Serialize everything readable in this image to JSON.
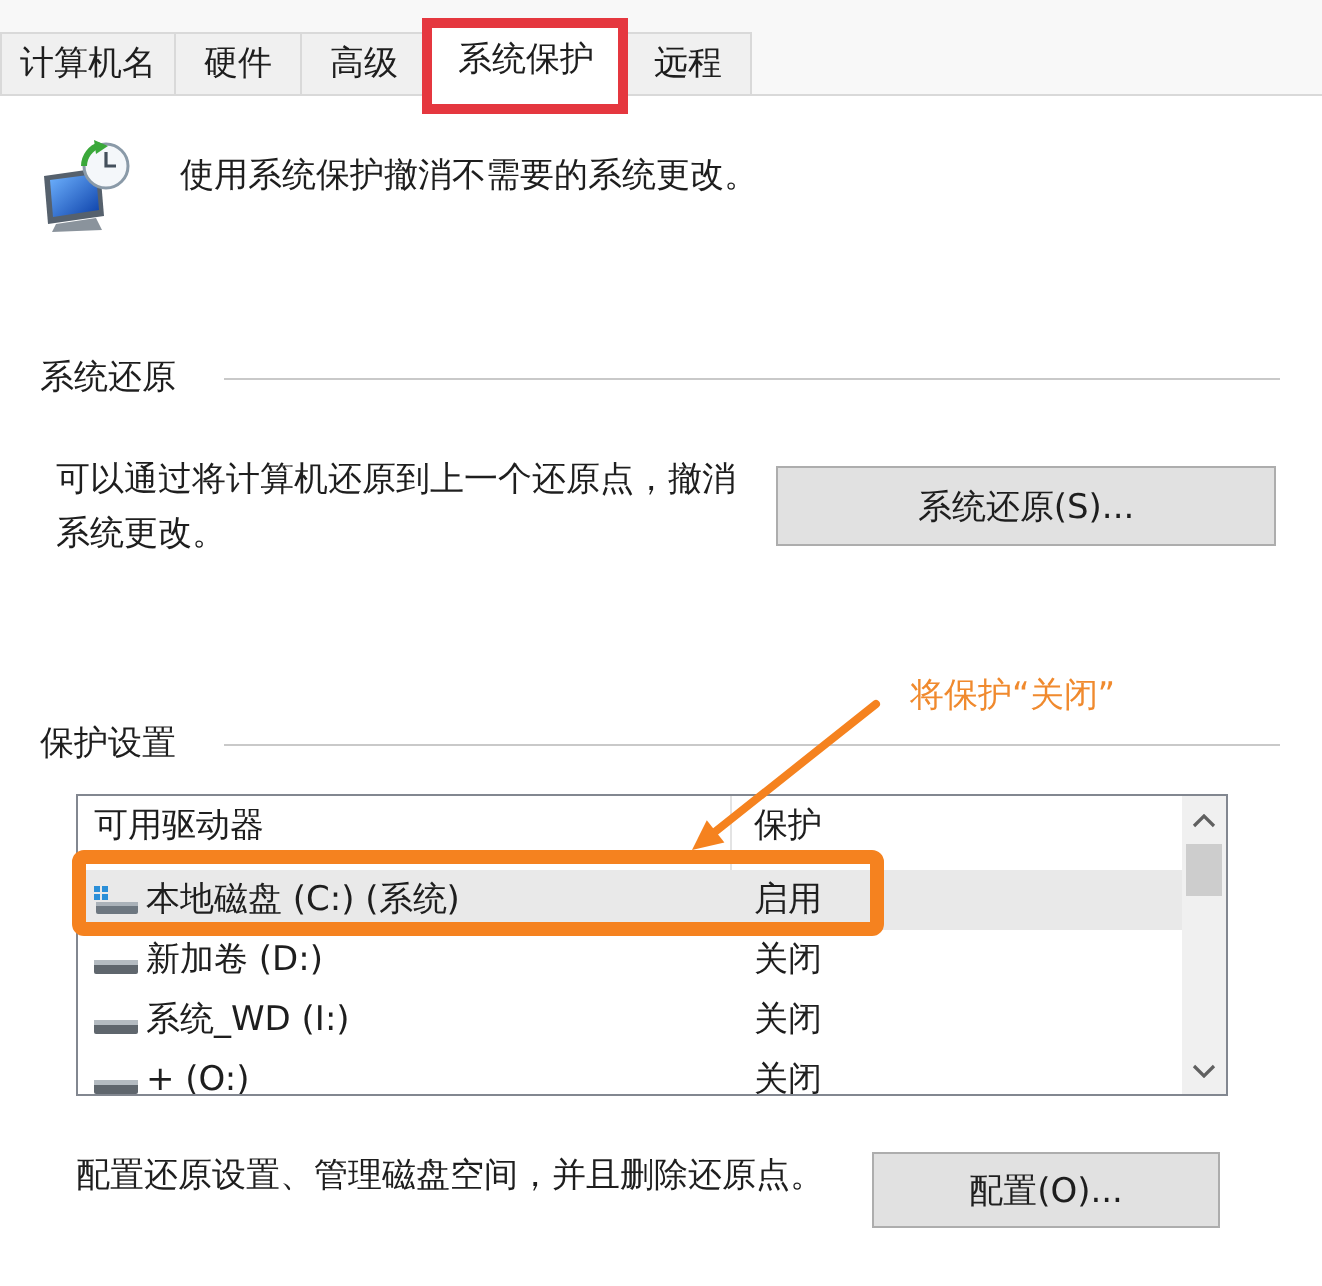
{
  "tabs": [
    {
      "label": "计算机名",
      "selected": false,
      "highlighted": false
    },
    {
      "label": "硬件",
      "selected": false,
      "highlighted": false
    },
    {
      "label": "高级",
      "selected": false,
      "highlighted": false
    },
    {
      "label": "系统保护",
      "selected": true,
      "highlighted": true
    },
    {
      "label": "远程",
      "selected": false,
      "highlighted": false
    }
  ],
  "intro": "使用系统保护撤消不需要的系统更改。",
  "restore_section": {
    "heading": "系统还原",
    "description": "可以通过将计算机还原到上一个还原点，撤消系统更改。",
    "button": "系统还原(S)..."
  },
  "protection_section": {
    "heading": "保护设置",
    "columns": [
      "可用驱动器",
      "保护"
    ],
    "drives": [
      {
        "name": "本地磁盘 (C:) (系统)",
        "protection": "启用",
        "kind": "system",
        "selected": true,
        "highlighted": true
      },
      {
        "name": "新加卷 (D:)",
        "protection": "关闭",
        "kind": "volume",
        "selected": false,
        "highlighted": false
      },
      {
        "name": "系统_WD (I:)",
        "protection": "关闭",
        "kind": "volume",
        "selected": false,
        "highlighted": false
      },
      {
        "name": "+ (O:)",
        "protection": "关闭",
        "kind": "volume",
        "selected": false,
        "highlighted": false
      }
    ],
    "description": "配置还原设置、管理磁盘空间，并且删除还原点。",
    "button": "配置(O)..."
  },
  "callout": {
    "text": "将保护“关闭”"
  }
}
